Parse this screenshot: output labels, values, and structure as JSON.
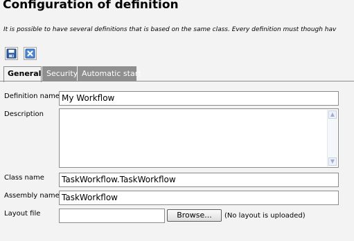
{
  "page": {
    "title": "Configuration of definition",
    "intro": "It is possible to have several definitions that is based on the same class. Every definition must though hav"
  },
  "toolbar": {
    "save_icon": "save-icon",
    "cancel_icon": "cancel-icon"
  },
  "tabs": [
    {
      "label": "General",
      "active": true
    },
    {
      "label": "Security",
      "active": false
    },
    {
      "label": "Automatic start",
      "active": false
    }
  ],
  "form": {
    "definition_name": {
      "label": "Definition name",
      "value": "My Workflow"
    },
    "description": {
      "label": "Description",
      "value": ""
    },
    "class_name": {
      "label": "Class name",
      "value": "TaskWorkflow.TaskWorkflow"
    },
    "assembly_name": {
      "label": "Assembly name",
      "value": "TaskWorkflow"
    },
    "layout_file": {
      "label": "Layout file",
      "browse_label": "Browse...",
      "status": "(No layout is uploaded)"
    }
  },
  "colors": {
    "background": "#f3f3f3",
    "inactive_tab": "#8f8f8f",
    "icon_blue": "#2f5fa8"
  }
}
